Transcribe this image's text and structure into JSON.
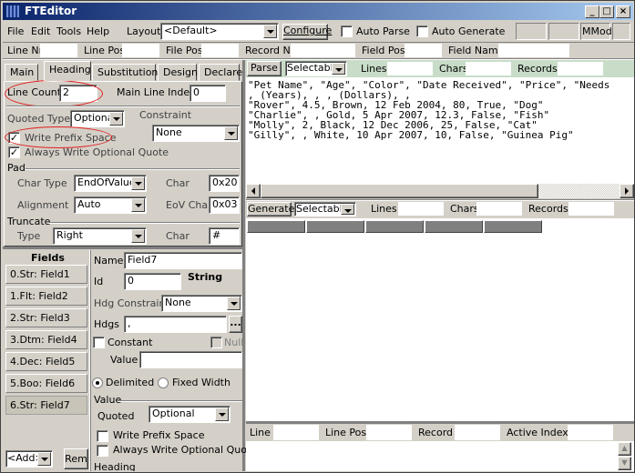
{
  "window": {
    "title": "FTEditor",
    "buttons": {
      "minimize": "_",
      "maximize": "□",
      "close": "×"
    }
  },
  "menu": {
    "items": [
      "File",
      "Edit",
      "Tools",
      "Help"
    ]
  },
  "toolbar": {
    "layout_label": "Layout",
    "layout_value": "<Default>",
    "configure_label": "Configure",
    "auto_parse_label": "Auto Parse",
    "auto_parse_checked": false,
    "auto_generate_label": "Auto Generate",
    "auto_generate_checked": false,
    "status_mmod": "MMod"
  },
  "positionbar": {
    "line_nr": "Line Nr",
    "line_pos": "Line Pos",
    "file_pos": "File Pos",
    "record_nr": "Record Nr",
    "field_pos": "Field Pos",
    "field_name": "Field Name"
  },
  "tabs": [
    {
      "label": "Main",
      "active": false
    },
    {
      "label": "Heading",
      "active": true
    },
    {
      "label": "Substitutions",
      "active": false
    },
    {
      "label": "Design",
      "active": false
    },
    {
      "label": "Declare",
      "active": false
    }
  ],
  "heading": {
    "line_count_label": "Line Count",
    "line_count_value": "2",
    "main_line_index_label": "Main Line Index",
    "main_line_index_value": "0",
    "quoted_type_label": "Quoted Type",
    "quoted_type_value": "Optional",
    "constraint_label": "Constraint",
    "constraint_value": "None",
    "write_prefix_space_label": "Write Prefix Space",
    "write_prefix_space_checked": true,
    "always_write_optional_quote_label": "Always Write Optional Quote",
    "always_write_optional_quote_checked": true,
    "pad_label": "Pad",
    "char_type_label": "Char Type",
    "char_type_value": "EndOfValue",
    "pad_char_label": "Char",
    "pad_char_value": "0x20",
    "alignment_label": "Alignment",
    "alignment_value": "Auto",
    "eov_char_label": "EoV Char",
    "eov_char_value": "0x03",
    "truncate_label": "Truncate",
    "truncate_type_label": "Type",
    "truncate_type_value": "Right",
    "truncate_char_label": "Char",
    "truncate_char_value": "#"
  },
  "fields": {
    "header": "Fields",
    "items": [
      "0.Str: Field1",
      "1.Flt: Field2",
      "2.Str: Field3",
      "3.Dtm: Field4",
      "4.Dec: Field5",
      "5.Boo: Field6",
      "6.Str: Field7"
    ],
    "selected_index": 6,
    "add_value": "<Add>",
    "rem_label": "Rem"
  },
  "field_props": {
    "name_label": "Name",
    "name_value": "Field7",
    "id_label": "Id",
    "id_value": "0",
    "type_text": "String",
    "hdg_constraint_label": "Hdg Constraint",
    "hdg_constraint_value": "None",
    "hdgs_label": "Hdgs",
    "hdgs_value": ",",
    "hdgs_button": "...",
    "constant_label": "Constant",
    "constant_checked": false,
    "null_label": "Null",
    "null_checked": false,
    "value_label": "Value",
    "value_value": "",
    "delimited_label": "Delimited",
    "delimited_selected": true,
    "fixed_width_label": "Fixed Width",
    "fixed_width_selected": false,
    "value_group_label": "Value",
    "quoted_label": "Quoted",
    "quoted_value": "Optional",
    "write_prefix_space_label": "Write Prefix Space",
    "write_prefix_space_checked": false,
    "always_write_optional_quote_label": "Always Write Optional Quote",
    "always_write_optional_quote_checked": false,
    "heading_group_label": "Heading"
  },
  "parse_panel": {
    "parse_label": "Parse",
    "mode_value": "Selectable",
    "lines_label": "Lines",
    "chars_label": "Chars",
    "records_label": "Records",
    "text_lines": [
      "\"Pet Name\", \"Age\", \"Color\", \"Date Received\", \"Price\", \"Needs",
      ", (Years), , , (Dollars), ,",
      "\"Rover\", 4.5, Brown, 12 Feb 2004, 80, True, \"Dog\"",
      "\"Charlie\", , Gold, 5 Apr 2007, 12.3, False, \"Fish\"",
      "\"Molly\", 2, Black, 12 Dec 2006, 25, False, \"Cat\"",
      "\"Gilly\", , White, 10 Apr 2007, 10, False, \"Guinea Pig\""
    ]
  },
  "generate_panel": {
    "generate_label": "Generate",
    "mode_value": "Selectable",
    "lines_label": "Lines",
    "chars_label": "Chars",
    "records_label": "Records",
    "grid_columns": 5
  },
  "bottom_status": {
    "line_label": "Line",
    "line_pos_label": "Line Pos",
    "record_label": "Record",
    "active_index_label": "Active Index"
  }
}
